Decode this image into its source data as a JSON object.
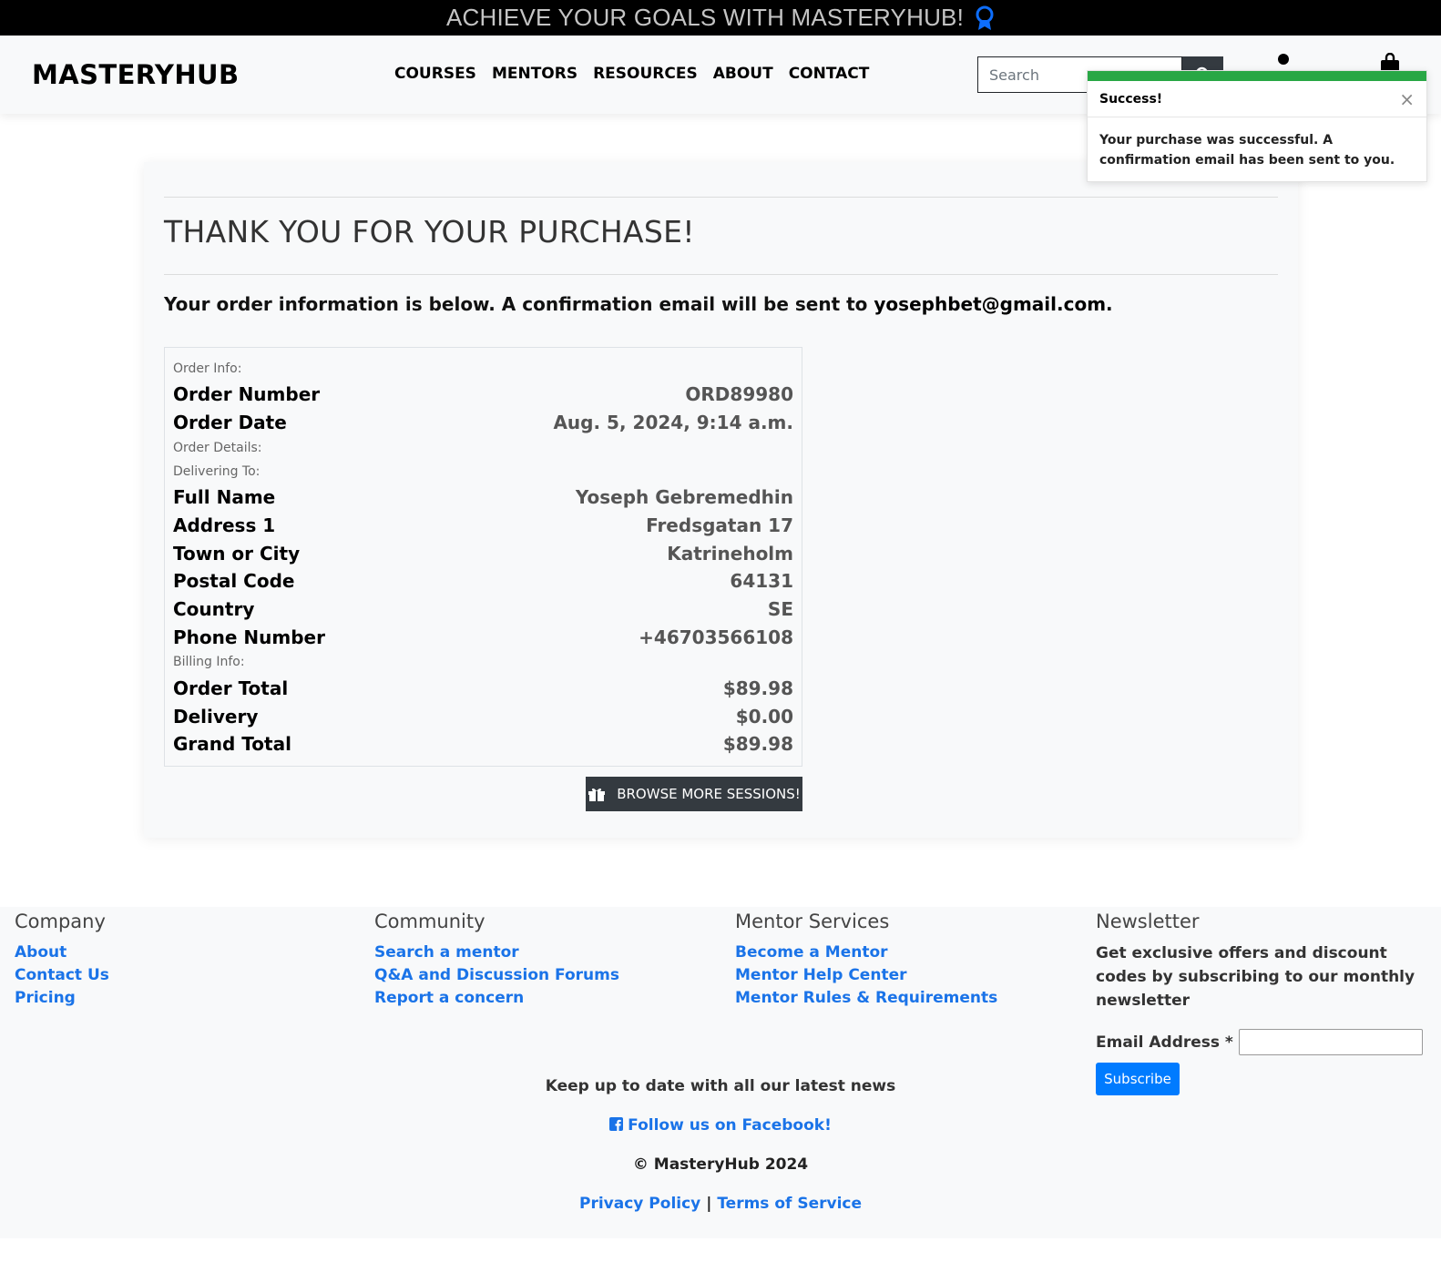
{
  "promo": {
    "text": "ACHIEVE YOUR GOALS WITH MASTERYHUB!",
    "icon": "award-ribbon-icon"
  },
  "header": {
    "brand": "MASTERYHUB",
    "nav": [
      "COURSES",
      "MENTORS",
      "RESOURCES",
      "ABOUT",
      "CONTACT"
    ],
    "search_placeholder": "Search",
    "icons": [
      "search-icon",
      "account-icon",
      "shopping-bag-icon"
    ]
  },
  "toast": {
    "title": "Success!",
    "close": "×",
    "message": "Your purchase was successful. A confirmation email has been sent to you.",
    "accent": "#28a745"
  },
  "confirmation": {
    "title": "THANK YOU FOR YOUR PURCHASE!",
    "intro_prefix": "Your order information is below. A confirmation email will be sent to ",
    "email": "yosephbet@gmail.com",
    "intro_suffix": ".",
    "order_info_label": "Order Info:",
    "order_number_label": "Order Number",
    "order_number": "ORD89980",
    "order_date_label": "Order Date",
    "order_date": "Aug. 5, 2024, 9:14 a.m.",
    "order_details_label": "Order Details:",
    "delivering_label": "Delivering To:",
    "full_name_label": "Full Name",
    "full_name": "Yoseph Gebremedhin",
    "address1_label": "Address 1",
    "address1": "Fredsgatan 17",
    "town_label": "Town or City",
    "town": "Katrineholm",
    "postal_label": "Postal Code",
    "postal": "64131",
    "country_label": "Country",
    "country": "SE",
    "phone_label": "Phone Number",
    "phone": "+46703566108",
    "billing_label": "Billing Info:",
    "order_total_label": "Order Total",
    "order_total": "$89.98",
    "delivery_label": "Delivery",
    "delivery": "$0.00",
    "grand_total_label": "Grand Total",
    "grand_total": "$89.98",
    "browse_button": "BROWSE MORE SESSIONS!"
  },
  "footer": {
    "company": {
      "title": "Company",
      "links": [
        "About",
        "Contact Us",
        "Pricing"
      ]
    },
    "community": {
      "title": "Community",
      "links": [
        "Search a mentor",
        "Q&A and Discussion Forums",
        "Report a concern"
      ]
    },
    "mentor_services": {
      "title": "Mentor Services",
      "links": [
        "Become a Mentor",
        "Mentor Help Center",
        "Mentor Rules & Requirements"
      ]
    },
    "newsletter": {
      "title": "Newsletter",
      "text": "Get exclusive offers and discount codes by subscribing to our monthly newsletter",
      "email_label": "Email Address *",
      "subscribe": "Subscribe"
    },
    "news_text": "Keep up to date with all our latest news",
    "facebook": "Follow us on Facebook!",
    "copyright": "© MasteryHub 2024",
    "privacy": "Privacy Policy",
    "separator": "|",
    "terms": "Terms of Service",
    "link_color": "#1a73e8"
  }
}
